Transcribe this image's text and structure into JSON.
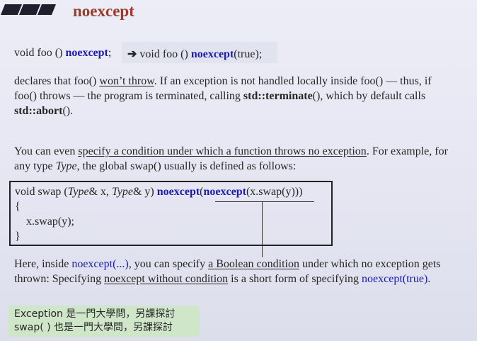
{
  "title": "noexcept",
  "line1": {
    "left_pre": "void foo () ",
    "left_kw": "noexcept",
    "left_post": ";",
    "arrow": "➔",
    "right_pre": " void foo () ",
    "right_kw": "noexcept",
    "right_post": "(true);"
  },
  "para1": {
    "l1_a": "declares that foo() ",
    "l1_u": "won’t throw",
    "l1_b": ". If an exception is not handled locally inside foo() — thus, if",
    "l2_a": "foo() throws — the program is terminated, calling ",
    "l2_b": "std::terminate",
    "l2_c": "(), which by default calls",
    "l3_a": "std::abort",
    "l3_b": "()."
  },
  "para2": {
    "l1_a": "You can even ",
    "l1_u": "specify a condition under which a function throws no exception",
    "l1_b": ". For example, for",
    "l2_a": "any type ",
    "l2_i": "Type",
    "l2_b": ", the global swap() usually is defined as follows:"
  },
  "code": {
    "l1_a": "void swap (",
    "l1_t1": "Type",
    "l1_b": "& x, ",
    "l1_t2": "Type",
    "l1_c": "& y) ",
    "l1_kw1": "noexcept",
    "l1_d": "(",
    "l1_kw2": "noexcept",
    "l1_e": "(x.swap(y)))",
    "l2": "{",
    "l3": "x.swap(y);",
    "l4": "}"
  },
  "para3": {
    "l1_a": "Here, inside ",
    "l1_kw": "noexcept(...)",
    "l1_b": ", you can specify ",
    "l1_u": "a Boolean condition",
    "l1_c": " under which no exception gets",
    "l2_a": "thrown: Specifying ",
    "l2_u": "noexcept without condition",
    "l2_b": " is a short form of specifying ",
    "l2_kw": "noexcept(true)",
    "l2_c": "."
  },
  "note": {
    "l1": "Exception 是一門大學問，另課探討",
    "l2": "swap( ) 也是一門大學問，另課探討"
  }
}
